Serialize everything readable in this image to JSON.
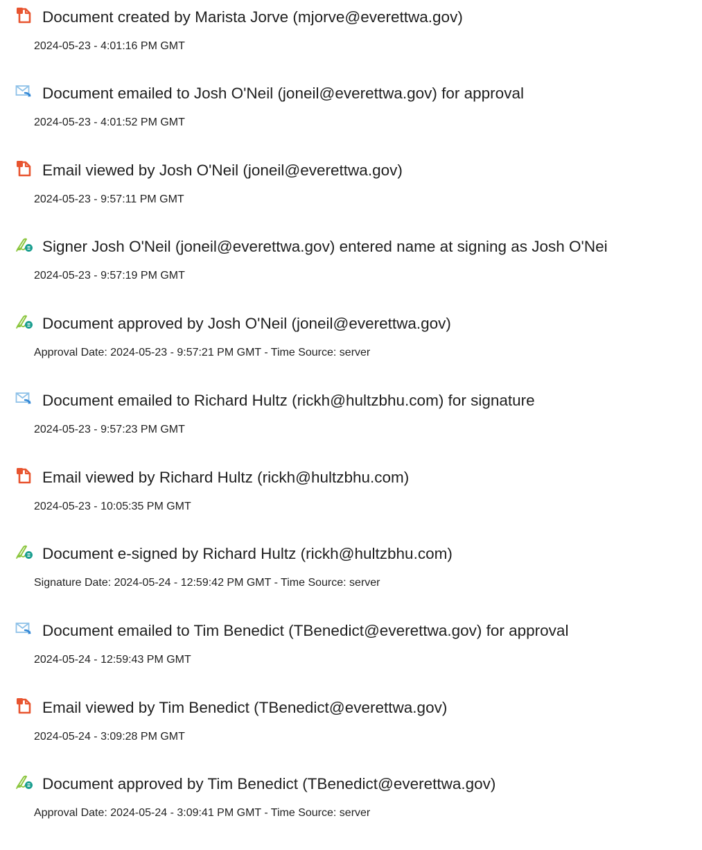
{
  "colors": {
    "doc_icon": "#e8542f",
    "email_icon_envelope": "#8ec1e8",
    "email_icon_arrow": "#2f86d6",
    "sign_icon_pen": "#8cc63f",
    "sign_icon_badge": "#1a9e8f"
  },
  "entries": [
    {
      "icon": "document-icon",
      "title": "Document created by Marista Jorve (mjorve@everettwa.gov)",
      "meta": "2024-05-23 - 4:01:16 PM GMT"
    },
    {
      "icon": "email-icon",
      "title": "Document emailed to Josh O'Neil (joneil@everettwa.gov) for approval",
      "meta": "2024-05-23 - 4:01:52 PM GMT"
    },
    {
      "icon": "document-icon",
      "title": "Email viewed by Josh O'Neil (joneil@everettwa.gov)",
      "meta": "2024-05-23 - 9:57:11 PM GMT"
    },
    {
      "icon": "signature-icon",
      "title": "Signer Josh O'Neil (joneil@everettwa.gov) entered name at signing as Josh O'Nei",
      "meta": "2024-05-23 - 9:57:19 PM GMT"
    },
    {
      "icon": "signature-icon",
      "title": "Document approved by Josh O'Neil (joneil@everettwa.gov)",
      "meta": "Approval Date: 2024-05-23 - 9:57:21 PM GMT - Time Source: server"
    },
    {
      "icon": "email-icon",
      "title": "Document emailed to Richard Hultz (rickh@hultzbhu.com) for signature",
      "meta": "2024-05-23 - 9:57:23 PM GMT"
    },
    {
      "icon": "document-icon",
      "title": "Email viewed by Richard Hultz (rickh@hultzbhu.com)",
      "meta": "2024-05-23 - 10:05:35 PM GMT"
    },
    {
      "icon": "signature-icon",
      "title": "Document e-signed by Richard Hultz (rickh@hultzbhu.com)",
      "meta": "Signature Date: 2024-05-24 - 12:59:42 PM GMT - Time Source: server"
    },
    {
      "icon": "email-icon",
      "title": "Document emailed to Tim Benedict (TBenedict@everettwa.gov) for approval",
      "meta": "2024-05-24 - 12:59:43 PM GMT"
    },
    {
      "icon": "document-icon",
      "title": "Email viewed by Tim Benedict (TBenedict@everettwa.gov)",
      "meta": "2024-05-24 - 3:09:28 PM GMT"
    },
    {
      "icon": "signature-icon",
      "title": "Document approved by Tim Benedict (TBenedict@everettwa.gov)",
      "meta": "Approval Date: 2024-05-24 - 3:09:41 PM GMT - Time Source: server"
    }
  ]
}
